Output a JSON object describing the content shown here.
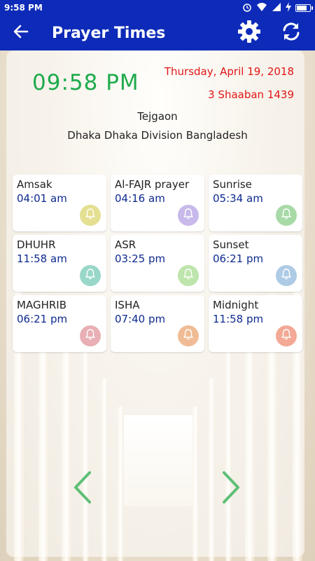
{
  "status_bar": {
    "time": "9:58 PM"
  },
  "app_bar": {
    "title": "Prayer Times",
    "icons": [
      "back-arrow-icon",
      "gear-icon",
      "refresh-icon"
    ]
  },
  "clock": "09:58 PM",
  "gregorian_date": "Thursday, April 19, 2018",
  "hijri_date": "3 Shaaban 1439",
  "location": {
    "city": "Tejgaon",
    "region": "Dhaka Dhaka Division Bangladesh"
  },
  "prayers": [
    {
      "name": "Amsak",
      "time": "04:01 am",
      "bell_color": "#e2dc86"
    },
    {
      "name": "Al-FAJR prayer",
      "time": "04:16 am",
      "bell_color": "#c3b2e9"
    },
    {
      "name": "Sunrise",
      "time": "05:34 am",
      "bell_color": "#9fd79e"
    },
    {
      "name": "DHUHR",
      "time": "11:58 am",
      "bell_color": "#8ed3c4"
    },
    {
      "name": "ASR",
      "time": "03:25 pm",
      "bell_color": "#b8e3a4"
    },
    {
      "name": "Sunset",
      "time": "06:21 pm",
      "bell_color": "#a6c6e3"
    },
    {
      "name": "MAGHRIB",
      "time": "06:21 pm",
      "bell_color": "#e6a7ad"
    },
    {
      "name": "ISHA",
      "time": "07:40 pm",
      "bell_color": "#efb58a"
    },
    {
      "name": "Midnight",
      "time": "11:58 pm",
      "bell_color": "#f2a08a"
    }
  ],
  "colors": {
    "app_bar": "#0d2bb8",
    "clock": "#1faa4c",
    "date": "#e01616",
    "time_text": "#0d2a8f",
    "nav_arrow": "#5fbf77"
  }
}
